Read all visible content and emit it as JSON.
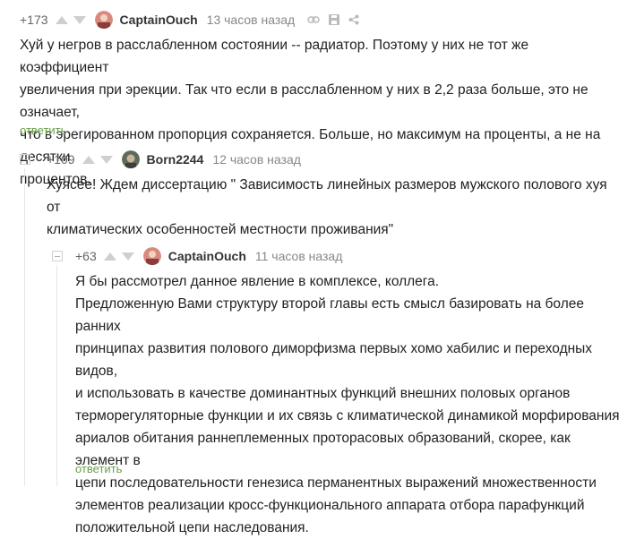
{
  "comments": [
    {
      "rating": "+173",
      "username": "CaptainOuch",
      "time": "13 часов назад",
      "lines": [
        "Хуй у негров в расслабленном состоянии -- радиатор. Поэтому у них не тот же коэффициент",
        "увеличения при эрекции. Так что если в расслабленном у них в 2,2 раза больше, это не означает,",
        "что в эрегированном пропорция сохраняется. Больше, но максимум на проценты, а не на десятки",
        "процентов."
      ],
      "reply": "ответить"
    },
    {
      "rating": "+109",
      "username": "Born2244",
      "time": "12 часов назад",
      "lines": [
        "Хуясее! Ждем диссертацию \" Зависимость линейных размеров мужского полового хуя от",
        "климатических особенностей местности проживания\""
      ]
    },
    {
      "rating": "+63",
      "username": "CaptainOuch",
      "time": "11 часов назад",
      "lines": [
        "Я бы рассмотрел данное явление в комплексе, коллега.",
        "Предложенную Вами структуру второй главы есть смысл базировать на более ранних",
        "принципах развития полового диморфизма первых хомо хабилис и переходных видов,",
        "и использовать в качестве доминантных функций внешних половых органов",
        "терморегуляторные функции и их связь с климатической динамикой морфирования",
        "ариалов обитания раннеплеменных проторасовых образований, скорее, как элемент в",
        "цепи последовательности генезиса перманентных выражений множественности",
        "элементов реализации кросс-функционального аппарата отбора парафункций",
        "положительной цепи наследования."
      ],
      "reply": "ответить"
    }
  ],
  "icons": [
    "upvote-icon",
    "downvote-icon",
    "link-icon",
    "save-icon",
    "share-icon",
    "collapse-icon"
  ]
}
